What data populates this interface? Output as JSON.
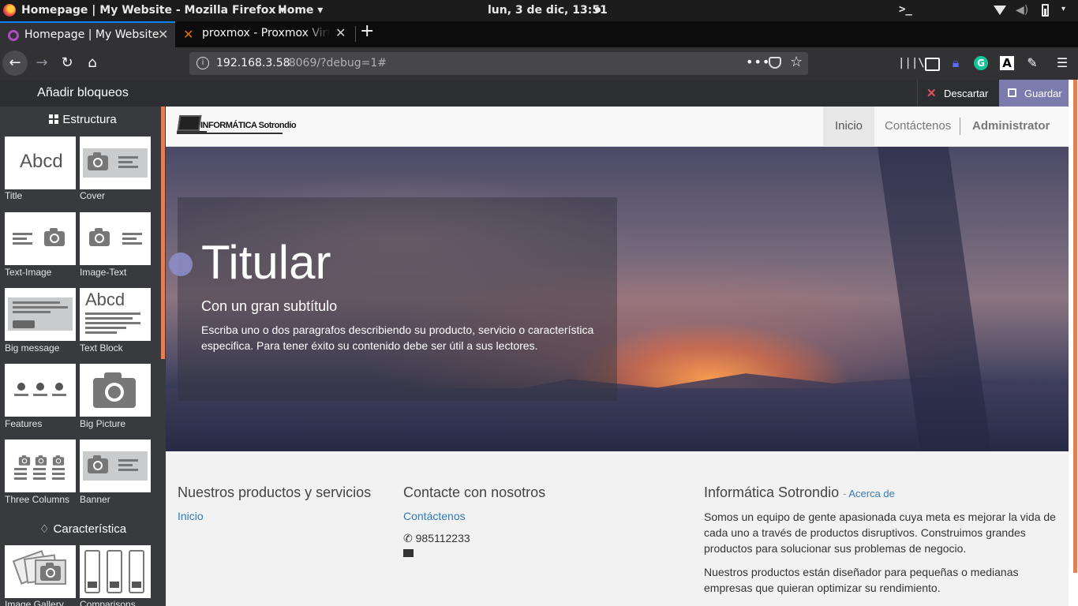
{
  "os": {
    "window_title": "Homepage | My Website - Mozilla Firefox",
    "app_menu": "Home",
    "clock": "lun,  3 de dic, 13:51",
    "terminal_glyph": ">_"
  },
  "browser": {
    "tabs": [
      {
        "label": "Homepage | My Website",
        "active": true,
        "close": "✕"
      },
      {
        "label": "proxmox - Proxmox Virtual Environment",
        "active": false,
        "close": "✕"
      }
    ],
    "new_tab": "+",
    "url_host": "192.168.3.58",
    "url_rest": ":8069/?debug=1#",
    "page_actions": "•••",
    "toolbar_icons": [
      "library-icon",
      "sidebar-icon",
      "lock-extension-icon",
      "grammarly-icon",
      "a-extension-icon",
      "gnome-extension-icon",
      "menu-icon"
    ]
  },
  "editor": {
    "panel_title": "Añadir bloqueos",
    "categories": [
      {
        "label": "Estructura",
        "icon": "grid-icon"
      },
      {
        "label": "Característica",
        "icon": "diamond-icon"
      }
    ],
    "snippets": [
      {
        "label": "Title",
        "thumb_text": "Abcd"
      },
      {
        "label": "Cover"
      },
      {
        "label": "Text-Image"
      },
      {
        "label": "Image-Text"
      },
      {
        "label": "Big message"
      },
      {
        "label": "Text Block",
        "thumb_text": "Abcd"
      },
      {
        "label": "Features"
      },
      {
        "label": "Big Picture"
      },
      {
        "label": "Three Columns"
      },
      {
        "label": "Banner"
      },
      {
        "label": "Image Gallery"
      },
      {
        "label": "Comparisons"
      }
    ],
    "discard_label": "Descartar",
    "save_label": "Guardar"
  },
  "site": {
    "logo_text": "INFORMÁTICA Sotrondio",
    "menu": [
      {
        "label": "Inicio",
        "active": true
      },
      {
        "label": "Contáctenos",
        "active": false
      },
      {
        "label": "Administrator",
        "active": false
      }
    ],
    "hero": {
      "title": "Titular",
      "subtitle": "Con un gran subtítulo",
      "body": "Escriba uno o dos paragrafos describiendo su producto, servicio o característica especifica. Para tener éxito su contenido debe ser útil a sus lectores."
    },
    "footer": {
      "col1": {
        "heading": "Nuestros productos y servicios",
        "link": "Inicio"
      },
      "col2": {
        "heading": "Contacte con nosotros",
        "link": "Contáctenos",
        "phone": "985112233"
      },
      "col3": {
        "heading": "Informática Sotrondio",
        "sep": "-",
        "about_link": "Acerca de",
        "para1": "Somos un equipo de gente apasionada cuya meta es mejorar la vida de cada uno a través de productos disruptivos. Construimos grandes productos para solucionar sus problemas de negocio.",
        "para2": "Nuestros productos están diseñador para pequeñas o medianas empresas que quieran optimizar su rendimiento."
      }
    }
  },
  "colors": {
    "editor_accent": "#e3805a",
    "save_button": "#7c7bad",
    "link": "#337ab7",
    "firefox_tab_accent": "#0a84ff"
  }
}
